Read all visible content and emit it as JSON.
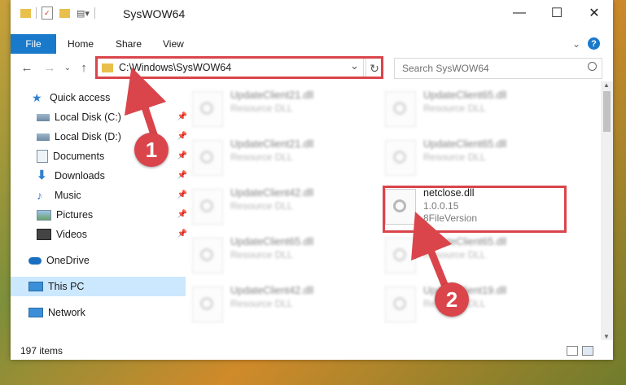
{
  "window": {
    "title": "SysWOW64",
    "minimize": "—",
    "maximize": "☐",
    "close": "✕"
  },
  "ribbon": {
    "file": "File",
    "tabs": [
      "Home",
      "Share",
      "View"
    ],
    "expand": "⌄",
    "help": "?"
  },
  "address": {
    "path": "C:\\Windows\\SysWOW64",
    "dropdown": "⌄",
    "refresh": "↻",
    "search_placeholder": "Search SysWOW64"
  },
  "sidebar": {
    "items": [
      {
        "label": "Quick access",
        "icon": "star-icon"
      },
      {
        "label": "Local Disk (C:)",
        "icon": "drive-icon",
        "pinned": true
      },
      {
        "label": "Local Disk (D:)",
        "icon": "drive-icon",
        "pinned": true
      },
      {
        "label": "Documents",
        "icon": "documents-icon",
        "pinned": true
      },
      {
        "label": "Downloads",
        "icon": "download-icon",
        "pinned": true
      },
      {
        "label": "Music",
        "icon": "music-icon",
        "pinned": true
      },
      {
        "label": "Pictures",
        "icon": "pictures-icon",
        "pinned": true
      },
      {
        "label": "Videos",
        "icon": "video-icon",
        "pinned": true
      },
      {
        "label": "OneDrive",
        "icon": "cloud-icon"
      },
      {
        "label": "This PC",
        "icon": "pc-icon",
        "selected": true
      },
      {
        "label": "Network",
        "icon": "network-icon"
      }
    ]
  },
  "files": {
    "left": [
      {
        "name": "UpdateClient21.dll",
        "type": "Resource DLL"
      },
      {
        "name": "UpdateClient21.dll",
        "type": "Resource DLL"
      },
      {
        "name": "UpdateClient42.dll",
        "type": "Resource DLL"
      },
      {
        "name": "UpdateClient65.dll",
        "type": "Resource DLL"
      },
      {
        "name": "UpdateClient42.dll",
        "type": "Resource DLL"
      }
    ],
    "right": [
      {
        "name": "UpdateClient65.dll",
        "type": "Resource DLL"
      },
      {
        "name": "UpdateClient65.dll",
        "type": "Resource DLL"
      },
      {
        "name": "UpdateClient65.dll",
        "type": "Resource DLL"
      },
      {
        "name": "UpdateClient19.dll",
        "type": "Resource DLL"
      }
    ],
    "highlighted": {
      "name": "netclose.dll",
      "version": "1.0.0.15",
      "description": "8FileVersion"
    }
  },
  "status": {
    "count": "197 items"
  },
  "callouts": [
    "1",
    "2"
  ],
  "colors": {
    "accent": "#1979ca",
    "highlight": "#d9454b",
    "selected_bg": "#cce8ff"
  }
}
